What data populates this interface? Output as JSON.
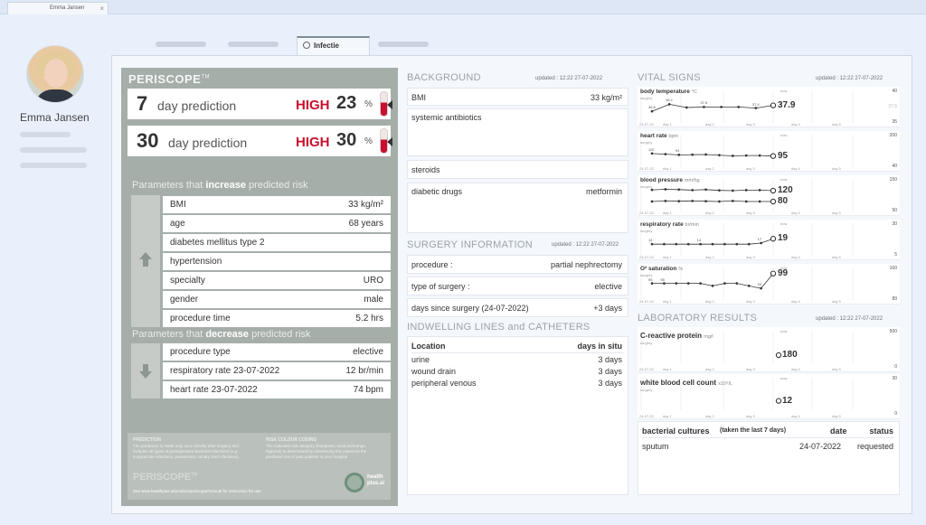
{
  "browser_tab": {
    "title": "Emma Jansen",
    "close": "×"
  },
  "user": {
    "name": "Emma Jansen"
  },
  "nav": {
    "active_tab": "Infectie"
  },
  "periscope": {
    "brand": "PERISCOPE",
    "tm": "TM",
    "predictions": [
      {
        "days": "7",
        "label": "day prediction",
        "level": "HIGH",
        "value": "23",
        "unit": "%",
        "fill": 0.55
      },
      {
        "days": "30",
        "label": "day prediction",
        "level": "HIGH",
        "value": "30",
        "unit": "%",
        "fill": 0.55
      }
    ],
    "increase_title_a": "Parameters that ",
    "increase_title_b": "increase",
    "increase_title_c": " predicted risk",
    "increase_params": [
      {
        "k": "BMI",
        "v": "33 kg/m²"
      },
      {
        "k": "age",
        "v": "68 years"
      },
      {
        "k": "diabetes mellitus type 2",
        "v": ""
      },
      {
        "k": "hypertension",
        "v": ""
      },
      {
        "k": "specialty",
        "v": "URO"
      },
      {
        "k": "gender",
        "v": "male"
      },
      {
        "k": "procedure time",
        "v": "5.2 hrs"
      }
    ],
    "decrease_title_a": "Parameters that ",
    "decrease_title_b": "decrease",
    "decrease_title_c": " predicted risk",
    "decrease_params": [
      {
        "k": "procedure type",
        "v": "elective"
      },
      {
        "k": "respiratory rate 23-07-2022",
        "v": "12 br/min"
      },
      {
        "k": "heart rate 23-07-2022",
        "v": "74 bpm"
      }
    ],
    "footer": {
      "prediction_h": "PREDICTION",
      "prediction_t": "The prediction is made only once directly after surgery and includes all types of postoperative bacterial infections (e.g. surgical site infections, pneumonia, urinary tract infections)",
      "coding_h": "RISK COLOUR CODING",
      "coding_t": "The indicated risk category (low/green, medium/orange, high/red) is determined by referencing this patient to the predicted risk of past patients in your hospital",
      "brand": "PERISCOPE",
      "tm": "TM",
      "url": "See www.healthplus.ai/product/periscope/manual for instruction for use",
      "logo_text_1": "health",
      "logo_text_2": "plus.ai"
    }
  },
  "background": {
    "title": "BACKGROUND",
    "updated": "updated : 12:22  27-07-2022",
    "bmi_label": "BMI",
    "bmi_value": "33 kg/m²",
    "antibiotics": "systemic antibiotics",
    "steroids": "steroids",
    "diabetic_label": "diabetic drugs",
    "diabetic_value": "metformin"
  },
  "surgery": {
    "title": "SURGERY INFORMATION",
    "updated": "updated : 12:22  27-07-2022",
    "rows": [
      {
        "k": "procedure :",
        "v": "partial nephrectomy"
      },
      {
        "k": "type of surgery :",
        "v": "elective"
      },
      {
        "k": "days since surgery (24-07-2022)",
        "v": "+3 days"
      }
    ]
  },
  "lines": {
    "title": "INDWELLING LINES and CATHETERS",
    "col_location": "Location",
    "col_days": "days in situ",
    "rows": [
      {
        "k": "urine",
        "v": "3 days"
      },
      {
        "k": "wound drain",
        "v": "3 days"
      },
      {
        "k": "peripheral venous",
        "v": "3 days"
      }
    ]
  },
  "vital_signs": {
    "title": "VITAL SIGNS",
    "updated": "updated : 12:22  27-07-2022",
    "axis": {
      "start": "24-07-22",
      "days": [
        "day 1",
        "day 2",
        "day 3",
        "day 4",
        "day 5"
      ],
      "now": "now",
      "surgery": "surgery"
    },
    "rows": [
      {
        "label": "body temperature",
        "unit": "°C",
        "current": "37.9",
        "max": "40",
        "min": "35",
        "mid_scale": "37.5",
        "values": [
          36.8,
          38.1,
          37.5,
          37.6,
          37.6,
          37.6,
          37.4,
          37.9
        ],
        "labels": [
          "36.8",
          "38.1",
          "",
          "37.6",
          "",
          "",
          "37.4",
          ""
        ]
      },
      {
        "label": "heart rate",
        "unit": "bpm",
        "current": "95",
        "max": "200",
        "min": "40",
        "values": [
          110,
          106,
          102,
          103,
          104,
          100,
          96,
          98,
          98,
          95
        ],
        "labels": [
          "110",
          "",
          "94",
          "",
          "",
          "",
          "",
          "",
          "",
          ""
        ]
      },
      {
        "label": "blood pressure",
        "unit": "mm/hg",
        "current": "120",
        "current2": "80",
        "max": "150",
        "min": "50",
        "values": [
          123,
          125,
          124,
          122,
          124,
          121,
          120,
          122,
          122,
          120
        ],
        "values2": [
          80,
          82,
          81,
          82,
          81,
          80,
          82,
          80,
          80,
          80
        ]
      },
      {
        "label": "respiratory rate",
        "unit": "br/min",
        "current": "19",
        "max": "30",
        "min": "5",
        "values": [
          14,
          14,
          14,
          14,
          14,
          14,
          14,
          14,
          14,
          15,
          19
        ],
        "labels": [
          "14",
          "",
          "",
          "",
          "14",
          "",
          "",
          "",
          "",
          "17",
          ""
        ]
      },
      {
        "label": "O² saturation",
        "unit": "%",
        "current": "99",
        "max": "100",
        "min": "89",
        "values": [
          95,
          95,
          95,
          95,
          95,
          94,
          95,
          95,
          94,
          93,
          99
        ],
        "labels": [
          "95",
          "95",
          "",
          "",
          "",
          "",
          "",
          "",
          "",
          "93",
          ""
        ]
      }
    ]
  },
  "laboratory": {
    "title": "LABORATORY RESULTS",
    "updated": "updated : 12:22  27-07-2022",
    "rows": [
      {
        "label": "C-reactive protein",
        "unit": "mg/l",
        "current": "180",
        "max": "500",
        "min": "0",
        "value": 180
      },
      {
        "label": "white blood cell count",
        "unit": "x10⁹/L",
        "current": "12",
        "max": "30",
        "min": "0",
        "value": 12
      }
    ],
    "cultures": {
      "title": "bacterial cultures",
      "subtitle": "(taken the last 7 days)",
      "col_date": "date",
      "col_status": "status",
      "rows": [
        {
          "k": "sputum",
          "date": "24-07-2022",
          "status": "requested"
        }
      ]
    }
  }
}
